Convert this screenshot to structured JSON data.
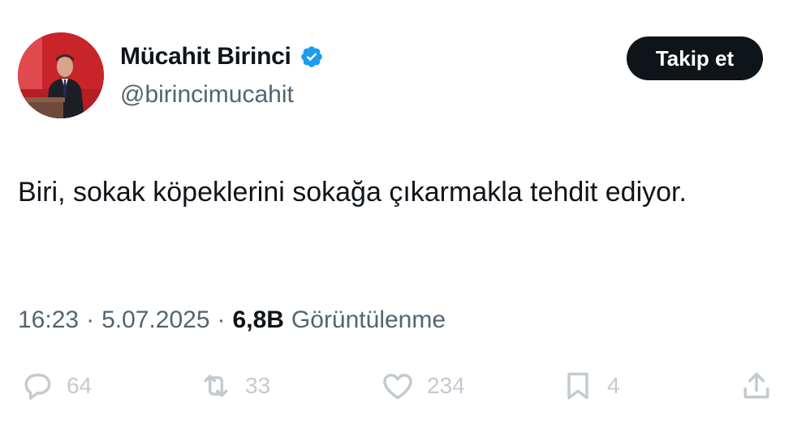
{
  "author": {
    "display_name": "Mücahit Birinci",
    "handle": "@birincimucahit",
    "verified_icon": "verified-badge-icon",
    "avatar_icon": "profile-photo"
  },
  "follow_button": {
    "label": "Takip et"
  },
  "tweet": {
    "text": "Biri, sokak köpeklerini sokağa çıkarmakla tehdit ediyor."
  },
  "meta": {
    "time": "16:23",
    "separator": "·",
    "date": "5.07.2025",
    "views_count": "6,8B",
    "views_label": "Görüntülenme"
  },
  "actions": {
    "reply_count": "64",
    "retweet_count": "33",
    "like_count": "234",
    "bookmark_count": "4"
  },
  "colors": {
    "accent_blue": "#1d9bf0",
    "text_primary": "#0f1419",
    "text_secondary": "#536471",
    "action_gray": "#c3cad0",
    "button_bg": "#0f1419"
  }
}
